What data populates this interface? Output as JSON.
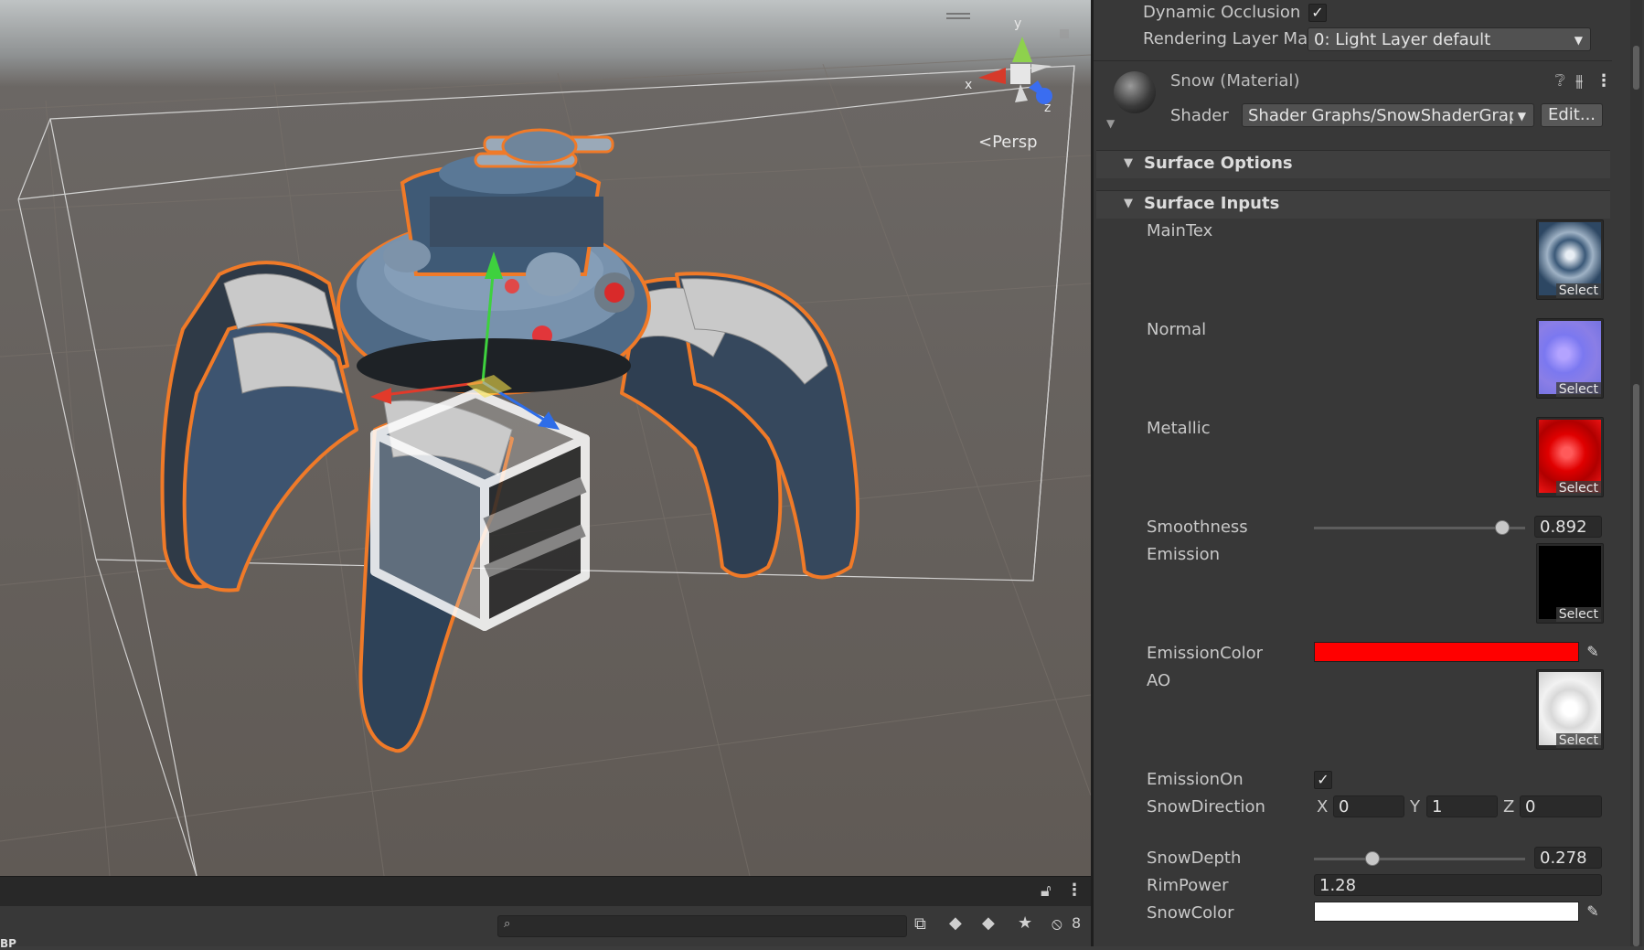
{
  "scene": {
    "persp_label": "Persp",
    "gizmo_axes": {
      "x": "x",
      "y": "y",
      "z": "z"
    },
    "outline_color": "#f07a28"
  },
  "toolbar": {
    "search_placeholder": "",
    "hidden_count": "8",
    "bottom_label": "BP"
  },
  "inspector": {
    "dynamic_occlusion": {
      "label": "Dynamic Occlusion",
      "checked": true
    },
    "rendering_layer": {
      "label": "Rendering Layer Ma",
      "value": "0: Light Layer default"
    },
    "material": {
      "name": "Snow (Material)",
      "shader_label": "Shader",
      "shader_value": "Shader Graphs/SnowShaderGraph",
      "edit_button": "Edit..."
    },
    "surface_options": "Surface Options",
    "surface_inputs": "Surface Inputs",
    "properties": {
      "main_tex": {
        "label": "MainTex",
        "select": "Select"
      },
      "normal": {
        "label": "Normal",
        "select": "Select"
      },
      "metallic": {
        "label": "Metallic",
        "select": "Select"
      },
      "smoothness": {
        "label": "Smoothness",
        "value": "0.892",
        "fraction": 0.892
      },
      "emission": {
        "label": "Emission",
        "select": "Select"
      },
      "emission_color": {
        "label": "EmissionColor",
        "color": "#ff0000"
      },
      "ao": {
        "label": "AO",
        "select": "Select"
      },
      "emission_on": {
        "label": "EmissionOn",
        "checked": true
      },
      "snow_direction": {
        "label": "SnowDirection",
        "x_label": "X",
        "x": "0",
        "y_label": "Y",
        "y": "1",
        "z_label": "Z",
        "z": "0"
      },
      "snow_depth": {
        "label": "SnowDepth",
        "value": "0.278",
        "fraction": 0.278
      },
      "rim_power": {
        "label": "RimPower",
        "value": "1.28"
      },
      "snow_color": {
        "label": "SnowColor",
        "color": "#ffffff"
      }
    }
  }
}
